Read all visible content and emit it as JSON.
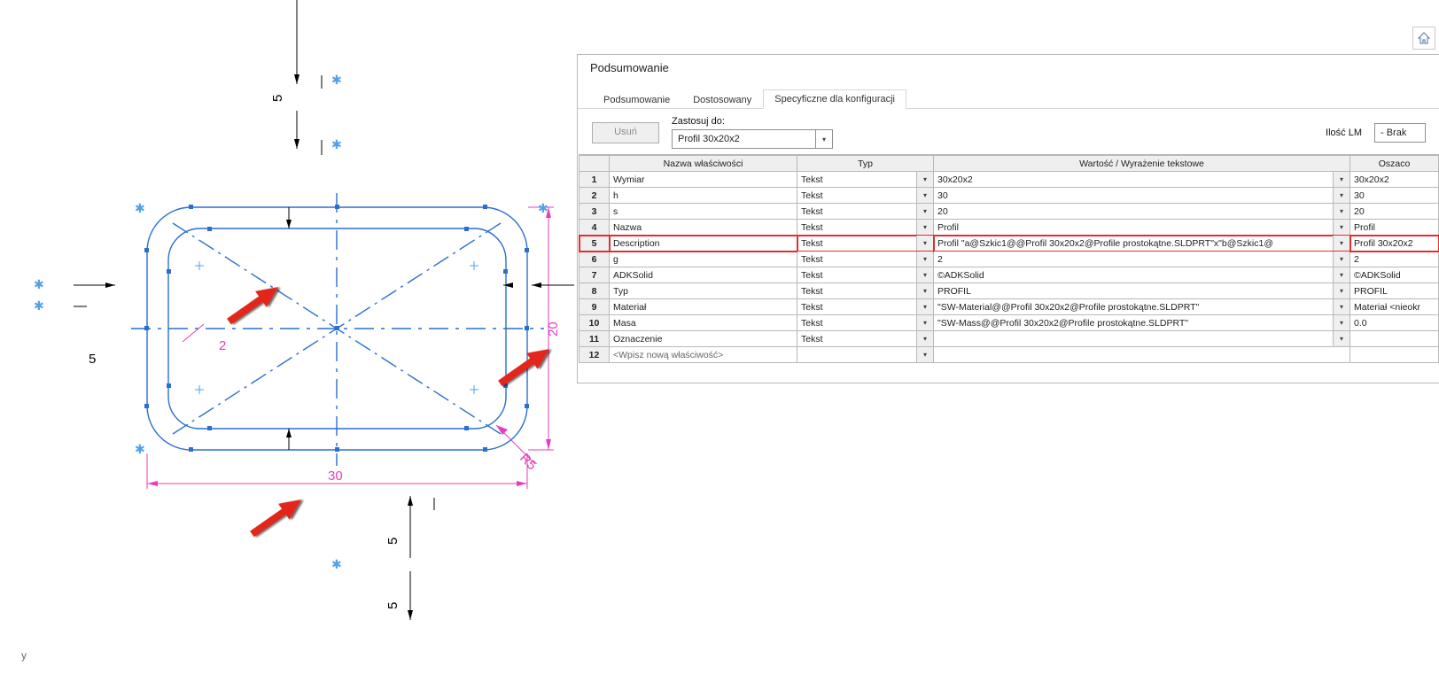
{
  "dialog": {
    "title": "Podsumowanie",
    "tabs": [
      "Podsumowanie",
      "Dostosowany",
      "Specyficzne dla konfiguracji"
    ],
    "activeTab": 2,
    "apply_label": "Zastosuj do:",
    "delete_label": "Usuń",
    "config_combo": "Profil 30x20x2",
    "bom_label": "Ilość LM",
    "bom_combo": "- Brak",
    "grid": {
      "headers": [
        "",
        "Nazwa właściwości",
        "Typ",
        "Wartość / Wyrażenie tekstowe",
        "Oszaco"
      ],
      "rows": [
        {
          "n": "1",
          "name": "Wymiar",
          "type": "Tekst",
          "val": "30x20x2",
          "eval": "30x20x2"
        },
        {
          "n": "2",
          "name": "h",
          "type": "Tekst",
          "val": "30",
          "eval": "30"
        },
        {
          "n": "3",
          "name": "s",
          "type": "Tekst",
          "val": "20",
          "eval": "20"
        },
        {
          "n": "4",
          "name": "Nazwa",
          "type": "Tekst",
          "val": "Profil",
          "eval": "Profil"
        },
        {
          "n": "5",
          "name": "Description",
          "type": "Tekst",
          "val": "Profil \"a@Szkic1@@Profil 30x20x2@Profile prostokątne.SLDPRT\"x\"b@Szkic1@",
          "eval": "Profil 30x20x2",
          "hi": true
        },
        {
          "n": "6",
          "name": "g",
          "type": "Tekst",
          "val": "2",
          "eval": "2"
        },
        {
          "n": "7",
          "name": "ADKSolid",
          "type": "Tekst",
          "val": "©ADKSolid",
          "eval": "©ADKSolid"
        },
        {
          "n": "8",
          "name": "Typ",
          "type": "Tekst",
          "val": "PROFIL",
          "eval": "PROFIL"
        },
        {
          "n": "9",
          "name": "Materiał",
          "type": "Tekst",
          "val": "\"SW-Material@@Profil 30x20x2@Profile prostokątne.SLDPRT\"",
          "eval": "Materiał <nieokr"
        },
        {
          "n": "10",
          "name": "Masa",
          "type": "Tekst",
          "val": "\"SW-Mass@@Profil 30x20x2@Profile prostokątne.SLDPRT\"",
          "eval": "0.0"
        },
        {
          "n": "11",
          "name": "Oznaczenie",
          "type": "Tekst",
          "val": "",
          "eval": ""
        },
        {
          "n": "12",
          "name": "<Wpisz nową właściwość>",
          "type": "",
          "val": "",
          "eval": "",
          "new": true
        }
      ]
    }
  },
  "drawing": {
    "dims": {
      "w": "30",
      "h": "20",
      "r": "R5",
      "t": "2",
      "off": "5"
    }
  }
}
